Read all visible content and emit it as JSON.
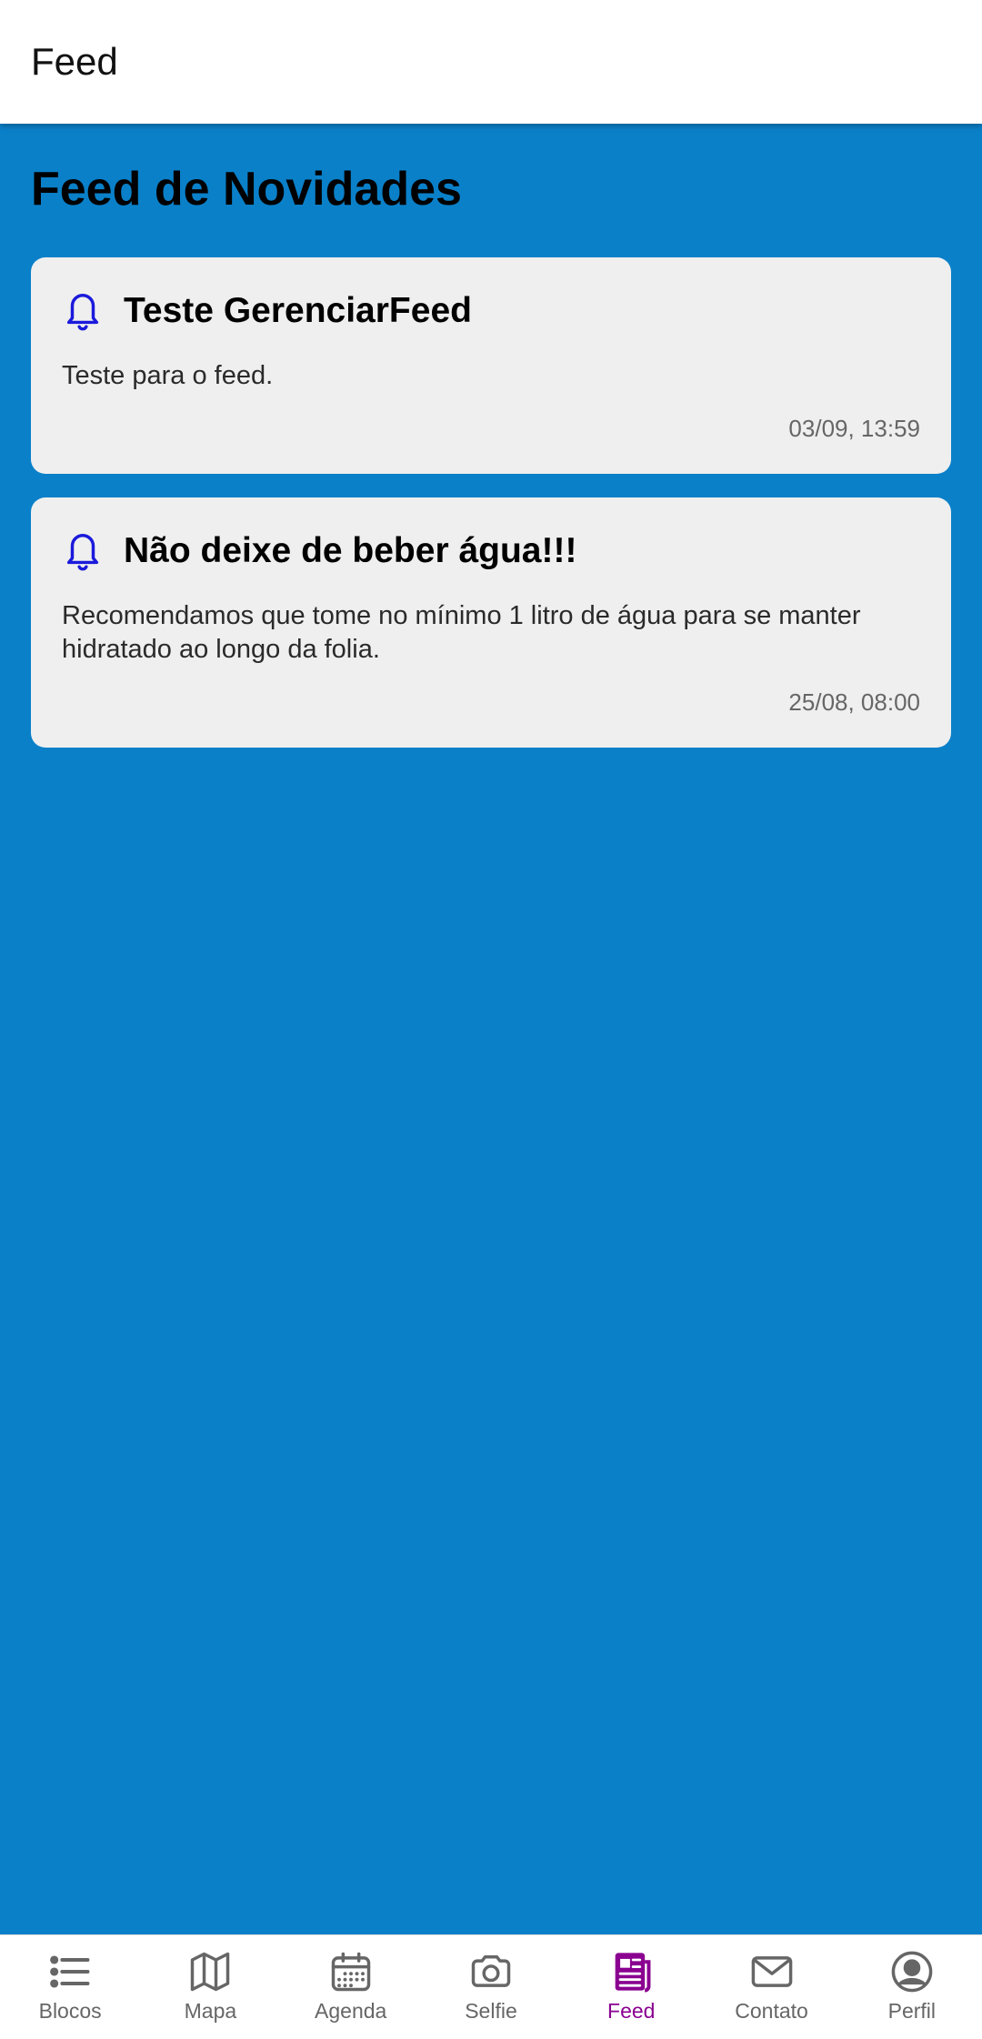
{
  "header": {
    "title": "Feed"
  },
  "page": {
    "title": "Feed de Novidades"
  },
  "feed": [
    {
      "title": "Teste GerenciarFeed",
      "body": "Teste para o feed.",
      "time": "03/09, 13:59",
      "icon": "bell-icon"
    },
    {
      "title": "Não deixe de beber água!!!",
      "body": "Recomendamos que tome no mínimo 1 litro de água para se manter hidratado ao longo da folia.",
      "time": "25/08, 08:00",
      "icon": "bell-icon"
    }
  ],
  "nav": [
    {
      "label": "Blocos",
      "icon": "list-icon"
    },
    {
      "label": "Mapa",
      "icon": "map-icon"
    },
    {
      "label": "Agenda",
      "icon": "calendar-icon"
    },
    {
      "label": "Selfie",
      "icon": "camera-icon"
    },
    {
      "label": "Feed",
      "icon": "newspaper-icon",
      "active": true
    },
    {
      "label": "Contato",
      "icon": "mail-icon"
    },
    {
      "label": "Perfil",
      "icon": "user-circle-icon"
    }
  ],
  "colors": {
    "background": "#0a80c9",
    "card": "#efefef",
    "accent_active": "#8a0090",
    "bell": "#1a1adc"
  }
}
